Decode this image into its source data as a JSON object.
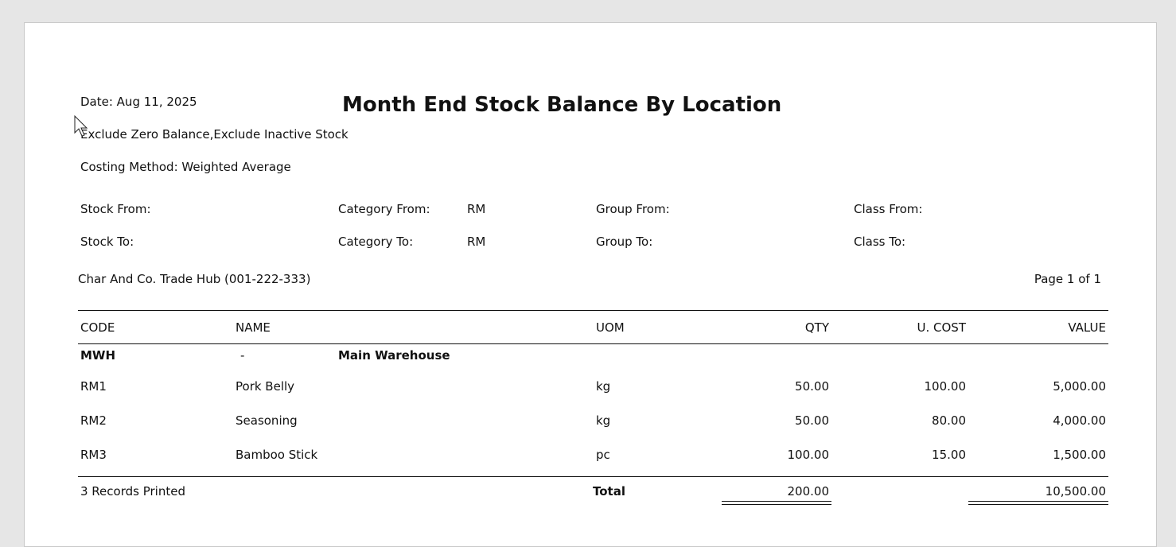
{
  "report": {
    "date": "Date: Aug 11, 2025",
    "title": "Month End Stock Balance By Location",
    "options": "Exclude Zero Balance,Exclude Inactive Stock",
    "costing": "Costing Method: Weighted Average"
  },
  "filters": {
    "stock_from_label": "Stock From:",
    "stock_to_label": "Stock To:",
    "category_from_label": "Category From:",
    "category_from_value": "RM",
    "category_to_label": "Category To:",
    "category_to_value": "RM",
    "group_from_label": "Group From:",
    "group_to_label": "Group To:",
    "class_from_label": "Class From:",
    "class_to_label": "Class To:"
  },
  "company": "Char And Co. Trade Hub (001-222-333)",
  "page": "Page 1 of 1",
  "table": {
    "headers": {
      "code": "CODE",
      "name": "NAME",
      "uom": "UOM",
      "qty": "QTY",
      "ucost": "U. COST",
      "value": "VALUE"
    },
    "location": {
      "code": "MWH",
      "dash": "-",
      "name": "Main Warehouse"
    },
    "rows": [
      {
        "code": "RM1",
        "name": "Pork Belly",
        "uom": "kg",
        "qty": "50.00",
        "ucost": "100.00",
        "value": "5,000.00"
      },
      {
        "code": "RM2",
        "name": "Seasoning",
        "uom": "kg",
        "qty": "50.00",
        "ucost": "80.00",
        "value": "4,000.00"
      },
      {
        "code": "RM3",
        "name": "Bamboo Stick",
        "uom": "pc",
        "qty": "100.00",
        "ucost": "15.00",
        "value": "1,500.00"
      }
    ],
    "footer": {
      "records": "3 Records Printed",
      "total_label": "Total",
      "total_qty": "200.00",
      "total_value": "10,500.00"
    }
  },
  "cursor_icon": "mouse-pointer-icon"
}
